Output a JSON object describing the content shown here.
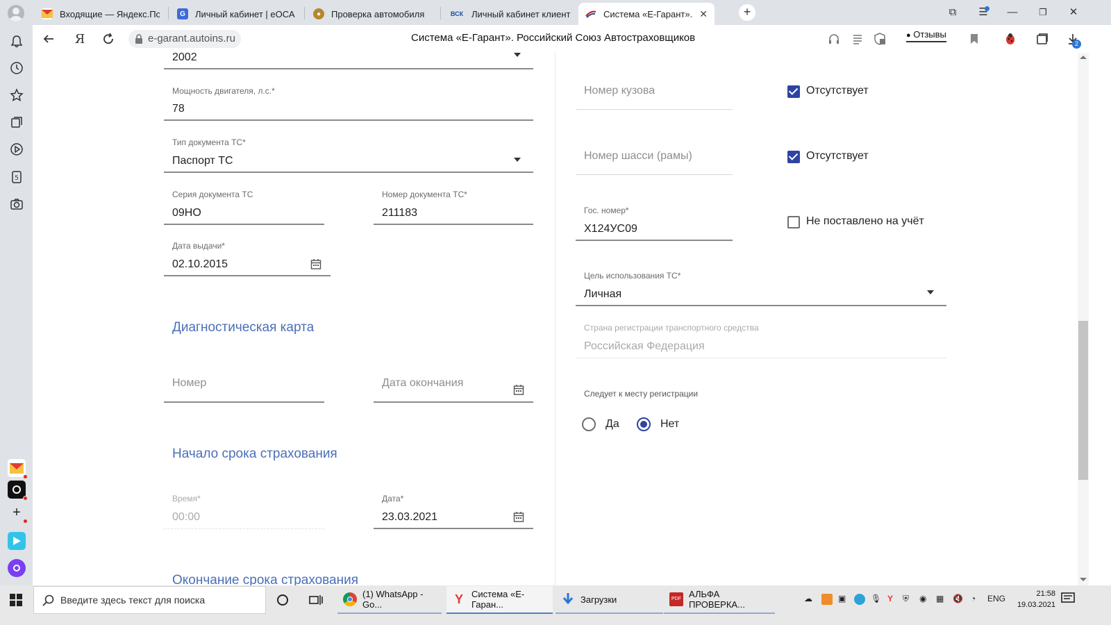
{
  "browser": {
    "tabs": [
      {
        "title": "Входящие — Яндекс.Почт",
        "icon": "mail-icon",
        "color": "#e53935"
      },
      {
        "title": "Личный кабинет | еОСАГС",
        "icon": "shield-icon",
        "color": "#3f6ad8"
      },
      {
        "title": "Проверка автомобиля",
        "icon": "emblem-icon",
        "color": "#b8862b"
      },
      {
        "title": "Личный кабинет клиента",
        "icon": "vsk-icon",
        "color": "#1d4f9b"
      },
      {
        "title": "Система «Е-Гарант». Рс",
        "icon": "rsa-icon",
        "color": "#c62828"
      }
    ],
    "url": "e-garant.autoins.ru",
    "page_title": "Система «Е-Гарант». Российский Союз Автостраховщиков",
    "feedback_label": "Отзывы",
    "downloads_badge": "2"
  },
  "form": {
    "left": {
      "year_value": "2002",
      "engine_power_label": "Мощность двигателя, л.с.*",
      "engine_power_value": "78",
      "doc_type_label": "Тип документа ТС*",
      "doc_type_value": "Паспорт ТС",
      "doc_series_label": "Серия документа ТС",
      "doc_series_value": "09НО",
      "doc_number_label": "Номер документа ТС*",
      "doc_number_value": "211183",
      "issue_date_label": "Дата выдачи*",
      "issue_date_value": "02.10.2015",
      "diag_title": "Диагностическая карта",
      "diag_number_placeholder": "Номер",
      "diag_end_placeholder": "Дата окончания",
      "start_title": "Начало срока страхования",
      "time_label": "Время*",
      "time_value": "00:00",
      "date_label": "Дата*",
      "date_value": "23.03.2021",
      "end_title": "Окончание срока страхования"
    },
    "right": {
      "body_number_placeholder": "Номер кузова",
      "body_absent_label": "Отсутствует",
      "body_absent_checked": true,
      "chassis_placeholder": "Номер шасси (рамы)",
      "chassis_absent_label": "Отсутствует",
      "chassis_absent_checked": true,
      "plate_label": "Гос. номер*",
      "plate_value": "Х124УС09",
      "not_registered_label": "Не поставлено на учёт",
      "not_registered_checked": false,
      "purpose_label": "Цель использования ТС*",
      "purpose_value": "Личная",
      "country_label": "Страна регистрации транспортного средства",
      "country_value": "Российская Федерация",
      "follows_label": "Следует к месту регистрации",
      "yes_label": "Да",
      "no_label": "Нет",
      "follows_selected": "Нет"
    }
  },
  "taskbar": {
    "search_placeholder": "Введите здесь текст для поиска",
    "items": [
      {
        "label": "(1) WhatsApp - Go...",
        "icon": "chrome-icon"
      },
      {
        "label": "Система «Е-Гаран...",
        "icon": "yandex-browser-icon"
      },
      {
        "label": "Загрузки",
        "icon": "downloads-icon"
      },
      {
        "label": "АЛЬФА ПРОВЕРКА...",
        "icon": "pdf-icon"
      }
    ],
    "lang": "ENG",
    "time": "21:58",
    "date": "19.03.2021"
  },
  "colors": {
    "accent": "#2e43a3",
    "section_title": "#4a6fb8"
  }
}
